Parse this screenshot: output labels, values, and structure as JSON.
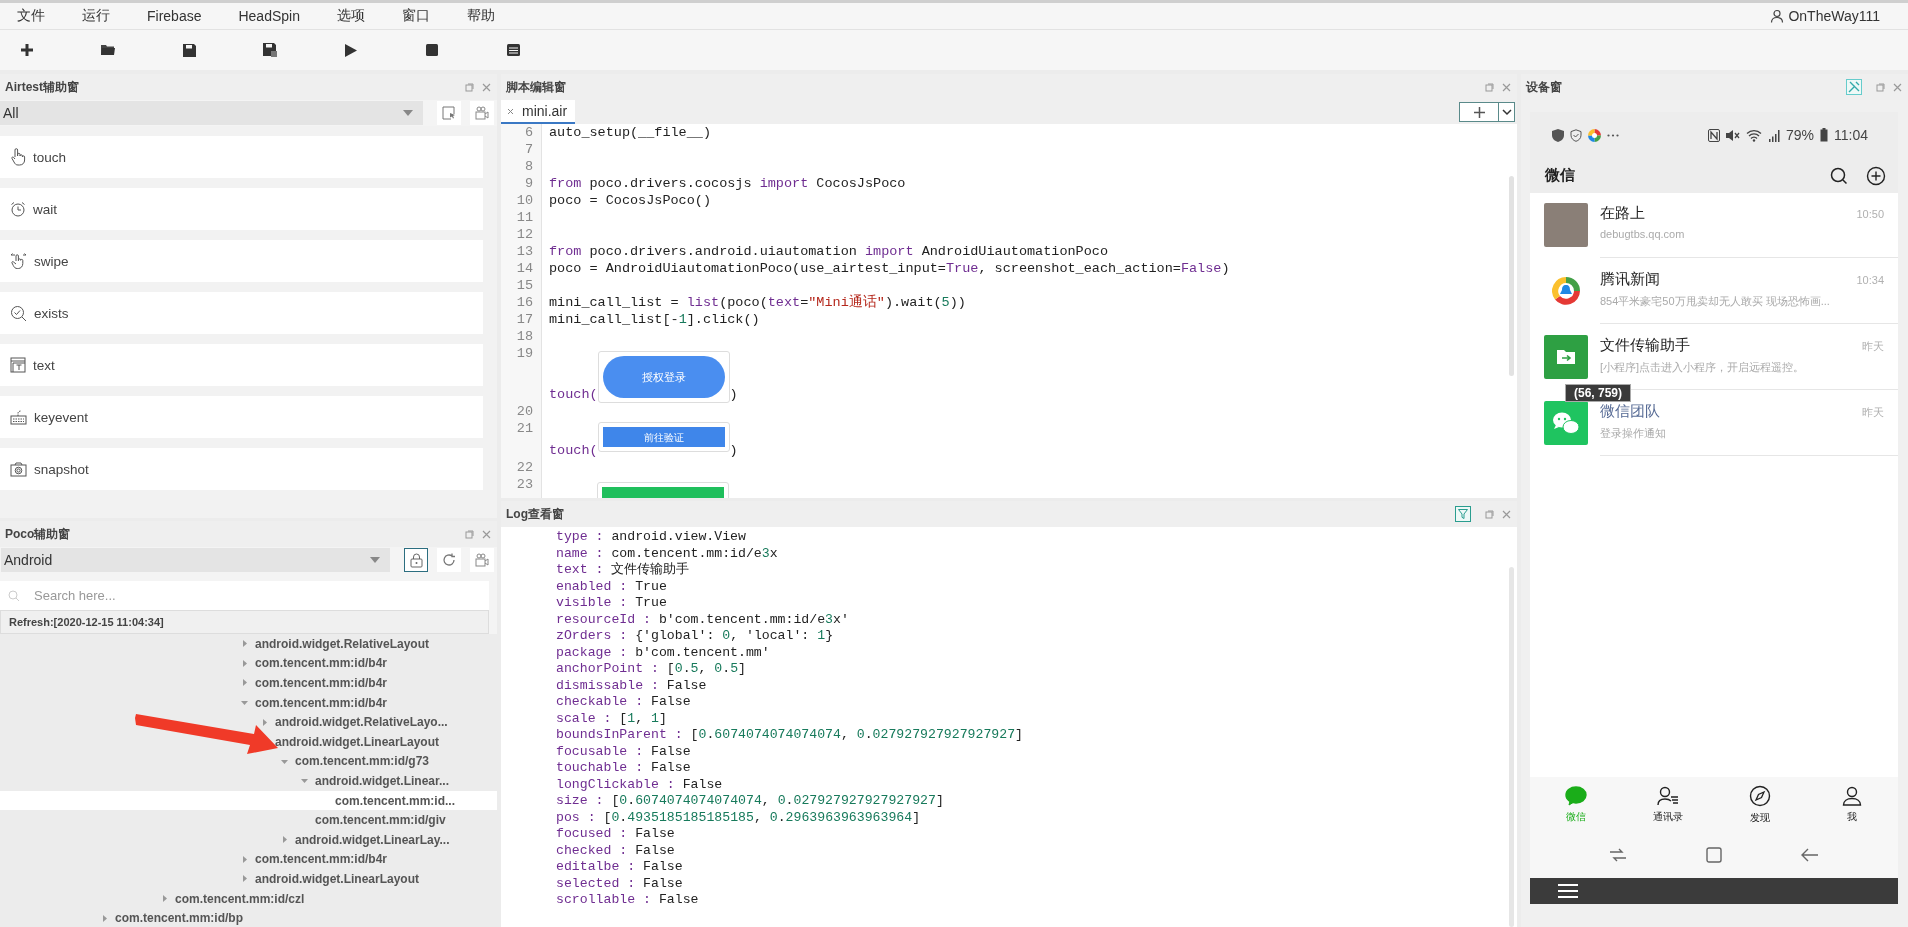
{
  "menu": [
    "文件",
    "运行",
    "Firebase",
    "HeadSpin",
    "选项",
    "窗口",
    "帮助"
  ],
  "user": {
    "name": "OnTheWay111"
  },
  "airtest": {
    "title": "Airtest辅助窗",
    "filter": "All",
    "actions": [
      {
        "kind": "touch",
        "label": "touch"
      },
      {
        "kind": "wait",
        "label": "wait"
      },
      {
        "kind": "swipe",
        "label": "swipe"
      },
      {
        "kind": "exists",
        "label": "exists"
      },
      {
        "kind": "text",
        "label": "text"
      },
      {
        "kind": "keyevent",
        "label": "keyevent"
      },
      {
        "kind": "snapshot",
        "label": "snapshot"
      }
    ]
  },
  "poco": {
    "title": "Poco辅助窗",
    "platform": "Android",
    "lock": {
      "selected": true
    },
    "search": {
      "placeholder": "Search here..."
    },
    "refresh": "Refresh:[2020-12-15 11:04:34]",
    "tree": [
      {
        "children": [
          {
            "children": [
              {
                "children": [
                  {
                    "children": [
                      {
                        "children": [
                          {
                            "children": [
                              {
                                "children": [
                                  {
                                    "label": "android.widget.RelativeLayout",
                                    "expanded": false,
                                    "selected": false
                                  },
                                  {
                                    "label": "com.tencent.mm:id/b4r",
                                    "expanded": false,
                                    "selected": false
                                  },
                                  {
                                    "label": "com.tencent.mm:id/b4r",
                                    "expanded": false,
                                    "selected": false
                                  },
                                  {
                                    "label": "com.tencent.mm:id/b4r",
                                    "expanded": true,
                                    "selected": false,
                                    "children": [
                                      {
                                        "label": "android.widget.RelativeLayo...",
                                        "expanded": false,
                                        "selected": false
                                      },
                                      {
                                        "label": "android.widget.LinearLayout",
                                        "expanded": true,
                                        "selected": false,
                                        "children": [
                                          {
                                            "label": "com.tencent.mm:id/g73",
                                            "expanded": true,
                                            "selected": false,
                                            "children": [
                                              {
                                                "label": "android.widget.Linear...",
                                                "expanded": true,
                                                "selected": false,
                                                "children": [
                                                  {
                                                    "label": "com.tencent.mm:id...",
                                                    "selected": true
                                                  }
                                                ]
                                              },
                                              {
                                                "label": "com.tencent.mm:id/giv",
                                                "selected": false
                                              }
                                            ]
                                          },
                                          {
                                            "label": "android.widget.LinearLay...",
                                            "expanded": false,
                                            "selected": false
                                          }
                                        ]
                                      }
                                    ]
                                  },
                                  {
                                    "label": "com.tencent.mm:id/b4r",
                                    "expanded": false,
                                    "selected": false
                                  },
                                  {
                                    "label": "android.widget.LinearLayout",
                                    "expanded": false,
                                    "selected": false
                                  }
                                ]
                              }
                            ]
                          }
                        ]
                      }
                    ]
                  },
                  {
                    "label": "com.tencent.mm:id/czl",
                    "expanded": false,
                    "selected": false
                  }
                ]
              }
            ]
          }
        ]
      },
      {
        "label": "com.tencent.mm:id/bp",
        "expanded": false,
        "selected": false
      }
    ]
  },
  "editor": {
    "title": "脚本编辑窗",
    "tabs": [
      {
        "label": "mini.air",
        "selected": true
      }
    ],
    "lines": [
      {
        "kind": "code",
        "number": "6",
        "tokens": [
          {
            "t": "auto_setup(__file__)",
            "kind": "plain"
          }
        ]
      },
      {
        "kind": "code",
        "number": "7"
      },
      {
        "kind": "code",
        "number": "8"
      },
      {
        "kind": "code",
        "number": "9",
        "tokens": [
          {
            "t": "from",
            "kind": "keyword"
          },
          {
            "t": " poco.drivers.cocosjs ",
            "kind": "plain"
          },
          {
            "t": "import",
            "kind": "keyword"
          },
          {
            "t": " CocosJsPoco",
            "kind": "plain"
          }
        ]
      },
      {
        "kind": "code",
        "number": "10",
        "tokens": [
          {
            "t": "poco = CocosJsPoco()",
            "kind": "plain"
          }
        ]
      },
      {
        "kind": "code",
        "number": "11"
      },
      {
        "kind": "code",
        "number": "12"
      },
      {
        "kind": "code",
        "number": "13",
        "tokens": [
          {
            "t": "from",
            "kind": "keyword"
          },
          {
            "t": " poco.drivers.android.uiautomation ",
            "kind": "plain"
          },
          {
            "t": "import",
            "kind": "keyword"
          },
          {
            "t": " AndroidUiautomationPoco",
            "kind": "plain"
          }
        ]
      },
      {
        "kind": "code",
        "number": "14",
        "tokens": [
          {
            "t": "poco = AndroidUiautomationPoco(use_airtest_input=",
            "kind": "plain"
          },
          {
            "t": "True",
            "kind": "keyword"
          },
          {
            "t": ", screenshot_each_action=",
            "kind": "plain"
          },
          {
            "t": "False",
            "kind": "keyword"
          },
          {
            "t": ")",
            "kind": "plain"
          }
        ]
      },
      {
        "kind": "code",
        "number": "15"
      },
      {
        "kind": "code",
        "number": "16",
        "tokens": [
          {
            "t": "mini_call_list = ",
            "kind": "plain"
          },
          {
            "t": "list",
            "kind": "keyword"
          },
          {
            "t": "(poco(",
            "kind": "plain"
          },
          {
            "t": "text",
            "kind": "keyword"
          },
          {
            "t": "=",
            "kind": "plain"
          },
          {
            "t": "\"Mini通话\"",
            "kind": "string"
          },
          {
            "t": ").wait(",
            "kind": "plain"
          },
          {
            "t": "5",
            "kind": "number"
          },
          {
            "t": "))",
            "kind": "plain"
          }
        ]
      },
      {
        "kind": "code",
        "number": "17",
        "tokens": [
          {
            "t": "mini_call_list[-",
            "kind": "plain"
          },
          {
            "t": "1",
            "kind": "number"
          },
          {
            "t": "].click()",
            "kind": "plain"
          }
        ]
      },
      {
        "kind": "code",
        "number": "18"
      },
      {
        "kind": "image",
        "number": "19",
        "before": "touch(",
        "image": {
          "kind": "pill",
          "label": "授权登录"
        },
        "after": ")"
      },
      {
        "kind": "code",
        "number": "20"
      },
      {
        "kind": "image",
        "number": "21",
        "before": "touch(",
        "image": {
          "kind": "bar",
          "label": "前往验证"
        },
        "after": ")"
      },
      {
        "kind": "code",
        "number": "22"
      },
      {
        "kind": "image",
        "number": "23",
        "image": {
          "kind": "block"
        }
      }
    ]
  },
  "log": {
    "title": "Log查看窗",
    "lines": [
      {
        "key": "type :",
        "value": "android.view.View"
      },
      {
        "key": "name :",
        "value": "com.tencent.mm:id/e3x"
      },
      {
        "key": "text :",
        "value": "文件传输助手"
      },
      {
        "key": "enabled :",
        "value": "True"
      },
      {
        "key": "visible :",
        "value": "True"
      },
      {
        "key": "resourceId :",
        "value": "b'com.tencent.mm:id/e3x'"
      },
      {
        "key": "zOrders :",
        "value": "{'global': 0, 'local': 1}"
      },
      {
        "key": "package :",
        "value": "b'com.tencent.mm'"
      },
      {
        "key": "anchorPoint :",
        "value": "[0.5, 0.5]"
      },
      {
        "key": "dismissable :",
        "value": "False"
      },
      {
        "key": "checkable :",
        "value": "False"
      },
      {
        "key": "scale :",
        "value": "[1, 1]"
      },
      {
        "key": "boundsInParent :",
        "value": "[0.6074074074074074, 0.027927927927927927]"
      },
      {
        "key": "focusable :",
        "value": "False"
      },
      {
        "key": "touchable :",
        "value": "False"
      },
      {
        "key": "longClickable :",
        "value": "False"
      },
      {
        "key": "size :",
        "value": "[0.6074074074074074, 0.027927927927927927]"
      },
      {
        "key": "pos :",
        "value": "[0.4935185185185185, 0.2963963963963964]"
      },
      {
        "key": "focused :",
        "value": "False"
      },
      {
        "key": "checked :",
        "value": "False"
      },
      {
        "key": "editalbe :",
        "value": "False"
      },
      {
        "key": "selected :",
        "value": "False"
      },
      {
        "key": "scrollable :",
        "value": "False"
      }
    ]
  },
  "device": {
    "title": "设备窗",
    "status": {
      "battery": "79%",
      "time": "11:04"
    },
    "app_title": "微信",
    "chats": [
      {
        "kind": "photo",
        "name": "在路上",
        "preview": "debugtbs.qq.com",
        "time": "10:50",
        "official": false
      },
      {
        "kind": "news",
        "name": "腾讯新闻",
        "preview": "854平米豪宅50万甩卖却无人敢买 现场恐怖画...",
        "time": "10:34",
        "official": false
      },
      {
        "kind": "file",
        "name": "文件传输助手",
        "preview": "[小程序]点击进入小程序，开启远程遥控。",
        "time": "昨天",
        "official": false
      },
      {
        "kind": "wechat",
        "name": "微信团队",
        "preview": "登录操作通知",
        "time": "昨天",
        "official": true
      }
    ],
    "tooltip": "(56, 759)",
    "tabs": [
      {
        "kind": "chats",
        "label": "微信",
        "selected": true
      },
      {
        "kind": "contacts",
        "label": "通讯录",
        "selected": false
      },
      {
        "kind": "discover",
        "label": "发现",
        "selected": false
      },
      {
        "kind": "me",
        "label": "我",
        "selected": false
      }
    ]
  }
}
